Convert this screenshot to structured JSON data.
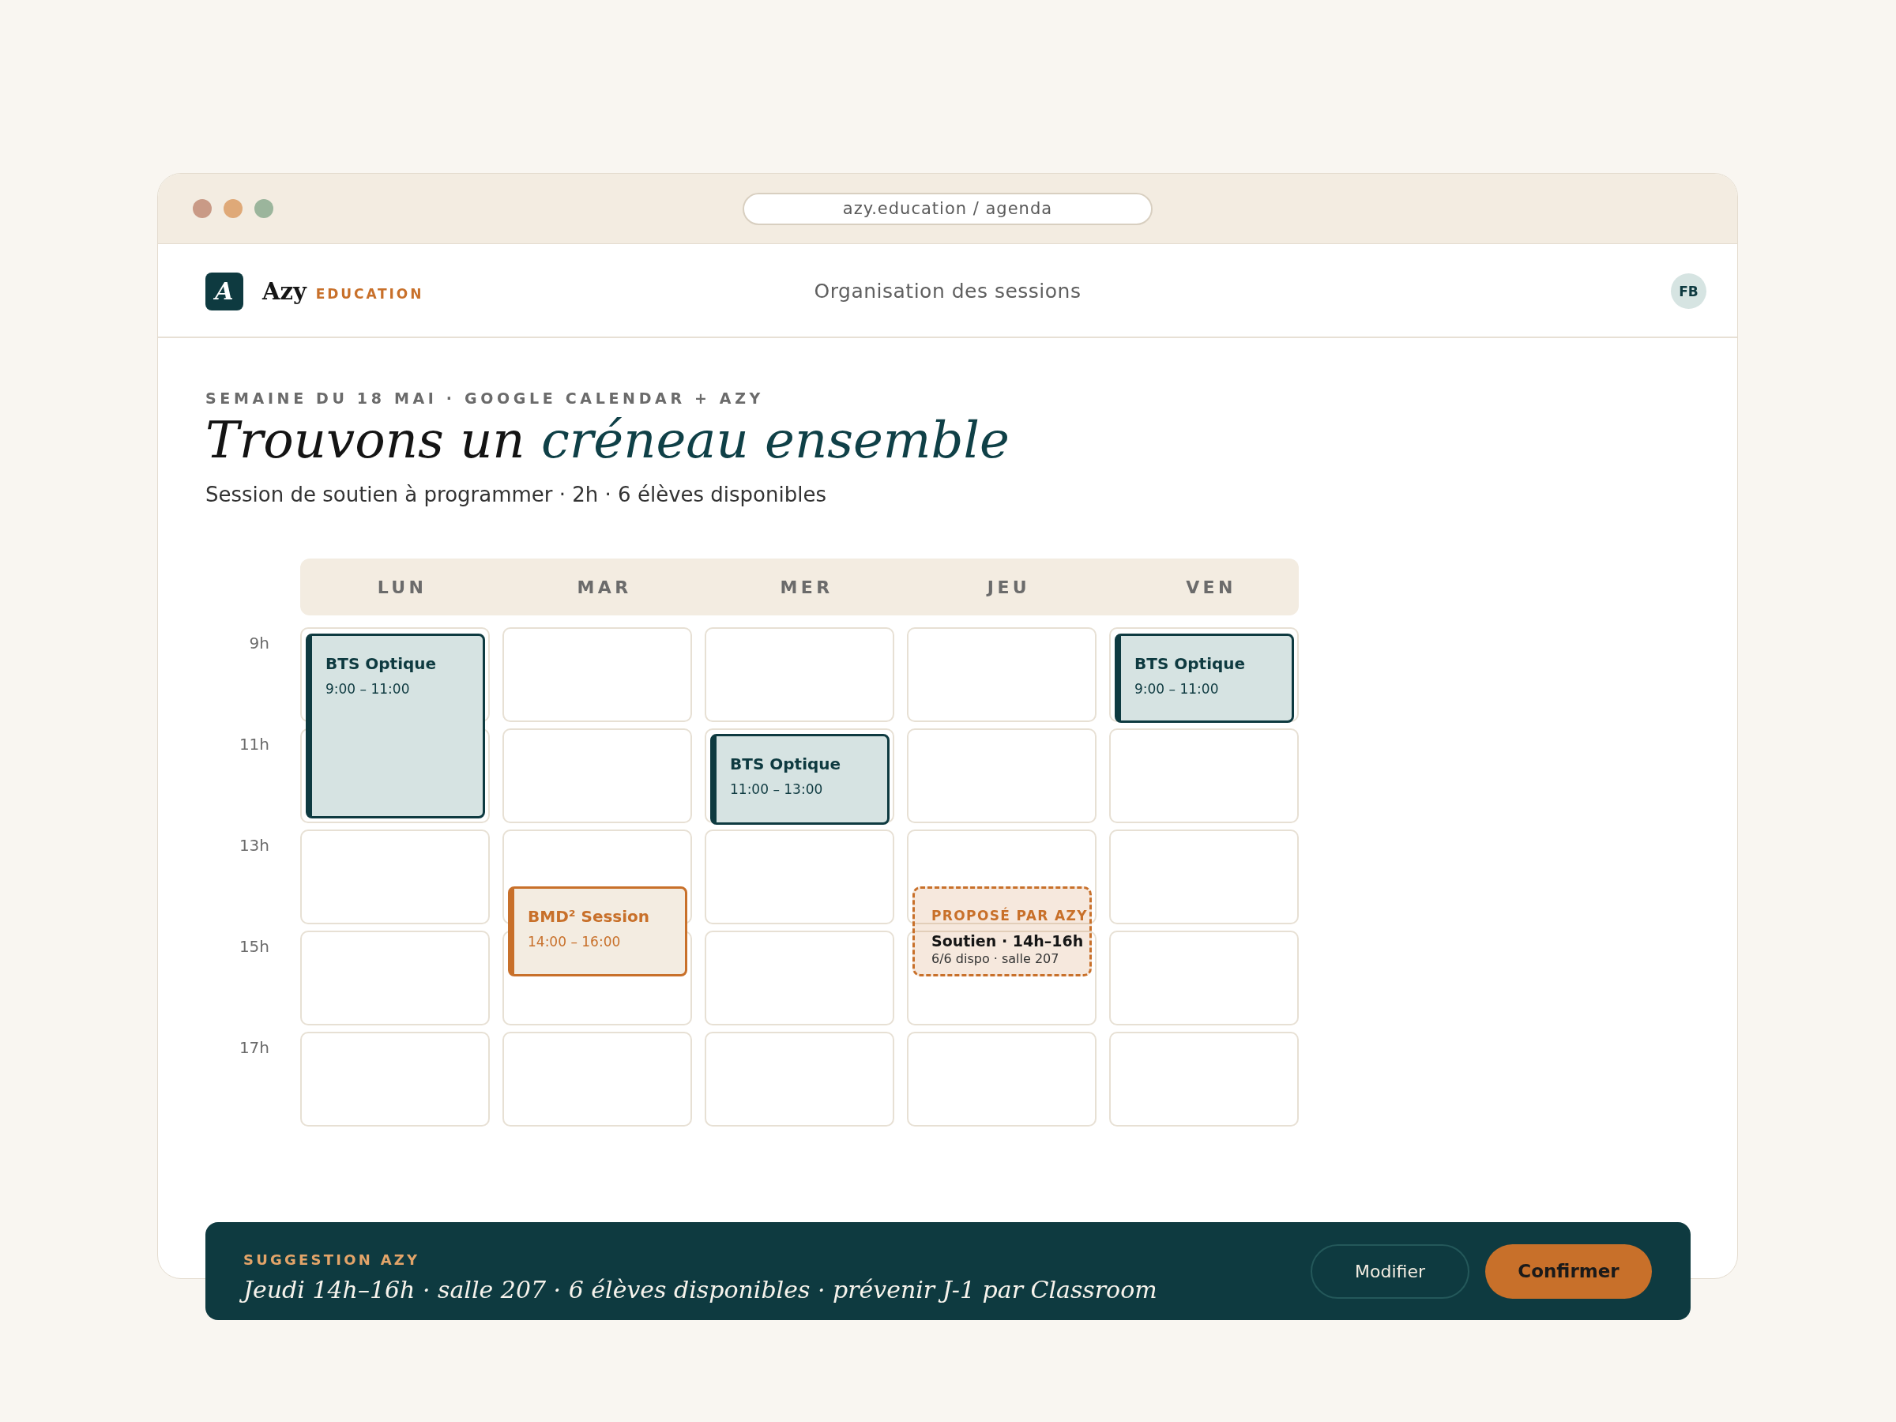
{
  "browser": {
    "address": "azy.education / agenda"
  },
  "header": {
    "logo_letter": "A",
    "brand": "Azy",
    "brand_tag": "EDUCATION",
    "title": "Organisation des sessions",
    "avatar_initials": "FB"
  },
  "intro": {
    "eyebrow": "SEMAINE DU 18 MAI · GOOGLE CALENDAR + AZY",
    "title_lead": "Trouvons un",
    "title_highlight": "créneau ensemble",
    "subtitle": "Session de soutien à programmer · 2h · 6 élèves disponibles"
  },
  "calendar": {
    "hours": [
      "9h",
      "11h",
      "13h",
      "15h",
      "17h"
    ],
    "days": [
      {
        "label": "LUN",
        "events": [
          {
            "kind": "course",
            "title": "BTS Optique",
            "time": "9:00 – 11:00"
          }
        ]
      },
      {
        "label": "MAR",
        "events": [
          {
            "kind": "session",
            "title": "BMD² Session",
            "time": "14:00 – 16:00"
          }
        ]
      },
      {
        "label": "MER",
        "events": [
          {
            "kind": "course",
            "title": "BTS Optique",
            "time": "11:00 – 13:00"
          }
        ]
      },
      {
        "label": "JEU",
        "events": [
          {
            "kind": "proposal",
            "label": "PROPOSÉ PAR AZY",
            "title": "Soutien · 14h–16h",
            "details": "6/6 dispo · salle 207"
          }
        ]
      },
      {
        "label": "VEN",
        "events": [
          {
            "kind": "course",
            "title": "BTS Optique",
            "time": "9:00 – 11:00"
          }
        ]
      }
    ]
  },
  "suggestion": {
    "label": "SUGGESTION AZY",
    "text": "Jeudi 14h–16h · salle 207 · 6 élèves disponibles · prévenir J-1 par Classroom",
    "buttons": [
      {
        "kind": "secondary",
        "label": "Modifier"
      },
      {
        "kind": "primary",
        "label": "Confirmer"
      }
    ]
  }
}
